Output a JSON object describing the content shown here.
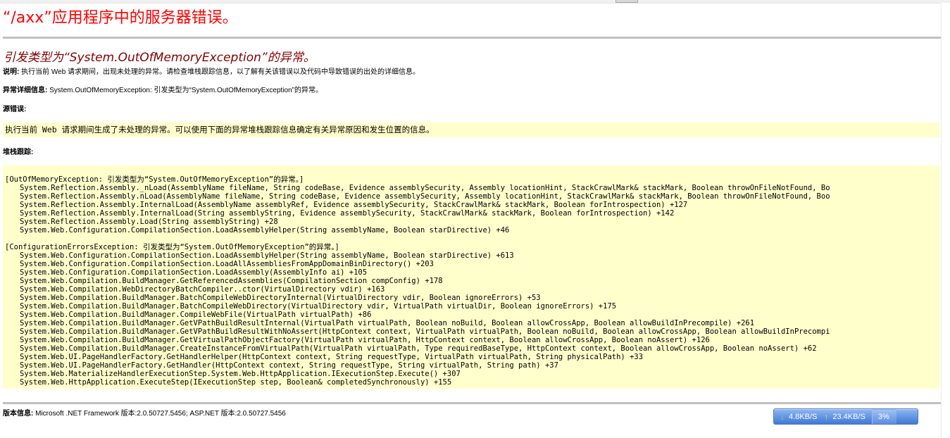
{
  "page": {
    "heading": "“/axx”应用程序中的服务器错误。",
    "exception_title": "引发类型为“System.OutOfMemoryException”的异常。"
  },
  "description": {
    "label": "说明:",
    "text": "执行当前 Web 请求期间，出现未处理的异常。请检查堆栈跟踪信息，以了解有关该错误以及代码中导致错误的出处的详细信息。"
  },
  "exception_details": {
    "label": "异常详细信息:",
    "text": "System.OutOfMemoryException: 引发类型为“System.OutOfMemoryException”的异常。"
  },
  "source_error": {
    "label": "源错误:",
    "text": "执行当前 Web 请求期间生成了未处理的异常。可以使用下面的异常堆栈跟踪信息确定有关异常原因和发生位置的信息。"
  },
  "stack_trace": {
    "label": "堆栈跟踪:",
    "blocks": [
      {
        "header": "[OutOfMemoryException: 引发类型为“System.OutOfMemoryException”的异常。]",
        "frames": [
          "System.Reflection.Assembly._nLoad(AssemblyName fileName, String codeBase, Evidence assemblySecurity, Assembly locationHint, StackCrawlMark& stackMark, Boolean throwOnFileNotFound, Bo",
          "System.Reflection.Assembly.nLoad(AssemblyName fileName, String codeBase, Evidence assemblySecurity, Assembly locationHint, StackCrawlMark& stackMark, Boolean throwOnFileNotFound, Boo",
          "System.Reflection.Assembly.InternalLoad(AssemblyName assemblyRef, Evidence assemblySecurity, StackCrawlMark& stackMark, Boolean forIntrospection) +127",
          "System.Reflection.Assembly.InternalLoad(String assemblyString, Evidence assemblySecurity, StackCrawlMark& stackMark, Boolean forIntrospection) +142",
          "System.Reflection.Assembly.Load(String assemblyString) +28",
          "System.Web.Configuration.CompilationSection.LoadAssemblyHelper(String assemblyName, Boolean starDirective) +46"
        ]
      },
      {
        "header": "[ConfigurationErrorsException: 引发类型为“System.OutOfMemoryException”的异常。]",
        "frames": [
          "System.Web.Configuration.CompilationSection.LoadAssemblyHelper(String assemblyName, Boolean starDirective) +613",
          "System.Web.Configuration.CompilationSection.LoadAllAssembliesFromAppDomainBinDirectory() +203",
          "System.Web.Configuration.CompilationSection.LoadAssembly(AssemblyInfo ai) +105",
          "System.Web.Compilation.BuildManager.GetReferencedAssemblies(CompilationSection compConfig) +178",
          "System.Web.Compilation.WebDirectoryBatchCompiler..ctor(VirtualDirectory vdir) +163",
          "System.Web.Compilation.BuildManager.BatchCompileWebDirectoryInternal(VirtualDirectory vdir, Boolean ignoreErrors) +53",
          "System.Web.Compilation.BuildManager.BatchCompileWebDirectory(VirtualDirectory vdir, VirtualPath virtualDir, Boolean ignoreErrors) +175",
          "System.Web.Compilation.BuildManager.CompileWebFile(VirtualPath virtualPath) +86",
          "System.Web.Compilation.BuildManager.GetVPathBuildResultInternal(VirtualPath virtualPath, Boolean noBuild, Boolean allowCrossApp, Boolean allowBuildInPrecompile) +261",
          "System.Web.Compilation.BuildManager.GetVPathBuildResultWithNoAssert(HttpContext context, VirtualPath virtualPath, Boolean noBuild, Boolean allowCrossApp, Boolean allowBuildInPrecompi",
          "System.Web.Compilation.BuildManager.GetVirtualPathObjectFactory(VirtualPath virtualPath, HttpContext context, Boolean allowCrossApp, Boolean noAssert) +126",
          "System.Web.Compilation.BuildManager.CreateInstanceFromVirtualPath(VirtualPath virtualPath, Type requiredBaseType, HttpContext context, Boolean allowCrossApp, Boolean noAssert) +62",
          "System.Web.UI.PageHandlerFactory.GetHandlerHelper(HttpContext context, String requestType, VirtualPath virtualPath, String physicalPath) +33",
          "System.Web.UI.PageHandlerFactory.GetHandler(HttpContext context, String requestType, String virtualPath, String path) +37",
          "System.Web.MaterializeHandlerExecutionStep.System.Web.HttpApplication.IExecutionStep.Execute() +307",
          "System.Web.HttpApplication.ExecuteStep(IExecutionStep step, Boolean& completedSynchronously) +155"
        ]
      }
    ]
  },
  "version_info": {
    "label": "版本信息:",
    "text": "Microsoft .NET Framework 版本:2.0.50727.5456; ASP.NET 版本:2.0.50727.5456"
  },
  "net_meter": {
    "download_icon": "arrow-down-icon",
    "download_speed": "4.8KB/S",
    "upload_icon": "arrow-up-icon",
    "upload_speed": "23.4KB/S",
    "cpu_percent": "3%",
    "colors": {
      "download": "#8be36b",
      "upload": "#ffd23a"
    }
  },
  "colors": {
    "heading": "#ff0000",
    "exception_title": "#800000",
    "code_background": "#ffffcc",
    "rule": "#c0c0c0"
  }
}
